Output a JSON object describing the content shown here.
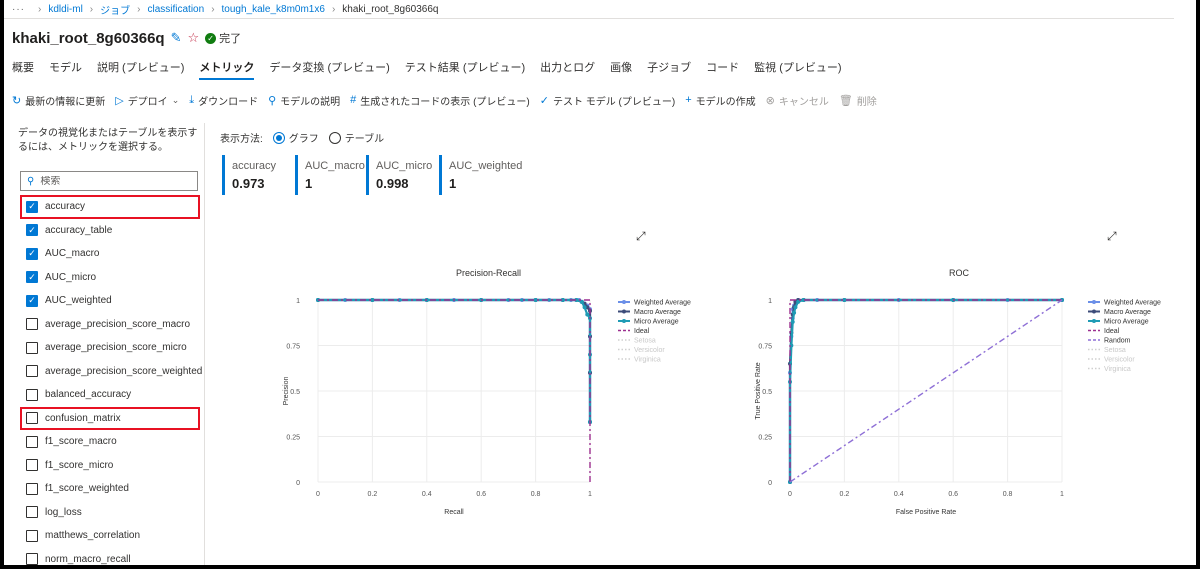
{
  "breadcrumb": {
    "dots": "···",
    "items": [
      "kdldi-ml",
      "ジョブ",
      "classification",
      "tough_kale_k8m0m1x6",
      "khaki_root_8g60366q"
    ]
  },
  "header": {
    "title": "khaki_root_8g60366q",
    "status": "完了"
  },
  "tabs": [
    "概要",
    "モデル",
    "説明 (プレビュー)",
    "メトリック",
    "データ変換 (プレビュー)",
    "テスト結果 (プレビュー)",
    "出力とログ",
    "画像",
    "子ジョブ",
    "コード",
    "監視 (プレビュー)"
  ],
  "active_tab": "メトリック",
  "toolbar": {
    "refresh": "最新の情報に更新",
    "deploy": "デプロイ",
    "download": "ダウンロード",
    "explain": "モデルの説明",
    "code": "生成されたコードの表示 (プレビュー)",
    "test": "テスト モデル (プレビュー)",
    "create": "モデルの作成",
    "cancel": "キャンセル",
    "delete": "削除"
  },
  "left_panel": {
    "instructions": "データの視覚化またはテーブルを表示するには、メトリックを選択する。",
    "search_placeholder": "検索",
    "metrics": [
      {
        "label": "accuracy",
        "checked": true,
        "highlighted": true
      },
      {
        "label": "accuracy_table",
        "checked": true,
        "highlighted": false
      },
      {
        "label": "AUC_macro",
        "checked": true,
        "highlighted": false
      },
      {
        "label": "AUC_micro",
        "checked": true,
        "highlighted": false
      },
      {
        "label": "AUC_weighted",
        "checked": true,
        "highlighted": false
      },
      {
        "label": "average_precision_score_macro",
        "checked": false,
        "highlighted": false
      },
      {
        "label": "average_precision_score_micro",
        "checked": false,
        "highlighted": false
      },
      {
        "label": "average_precision_score_weighted",
        "checked": false,
        "highlighted": false
      },
      {
        "label": "balanced_accuracy",
        "checked": false,
        "highlighted": false
      },
      {
        "label": "confusion_matrix",
        "checked": false,
        "highlighted": true
      },
      {
        "label": "f1_score_macro",
        "checked": false,
        "highlighted": false
      },
      {
        "label": "f1_score_micro",
        "checked": false,
        "highlighted": false
      },
      {
        "label": "f1_score_weighted",
        "checked": false,
        "highlighted": false
      },
      {
        "label": "log_loss",
        "checked": false,
        "highlighted": false
      },
      {
        "label": "matthews_correlation",
        "checked": false,
        "highlighted": false
      },
      {
        "label": "norm_macro_recall",
        "checked": false,
        "highlighted": false
      }
    ]
  },
  "view": {
    "label": "表示方法:",
    "graph": "グラフ",
    "table": "テーブル",
    "selected": "graph"
  },
  "cards": [
    {
      "name": "accuracy",
      "value": "0.973"
    },
    {
      "name": "AUC_macro",
      "value": "1"
    },
    {
      "name": "AUC_micro",
      "value": "0.998"
    },
    {
      "name": "AUC_weighted",
      "value": "1"
    }
  ],
  "colors": {
    "accent": "#0078d4",
    "weighted": "#6b8fe8",
    "macro": "#3d4c7a",
    "micro": "#1f9bb5",
    "ideal": "#9c2f8f",
    "random": "#8e6fd6",
    "hidden": "#cfcfcf",
    "highlight": "#e81123"
  },
  "chart_data": [
    {
      "type": "line",
      "title": "Precision-Recall",
      "xlabel": "Recall",
      "ylabel": "Precision",
      "xlim": [
        0,
        1
      ],
      "ylim": [
        0,
        1
      ],
      "xticks": [
        "0",
        "0.2",
        "0.4",
        "0.6",
        "0.8",
        "1"
      ],
      "yticks": [
        "0",
        "0.25",
        "0.5",
        "0.75",
        "1"
      ],
      "grid": true,
      "legend_position": "right",
      "series": [
        {
          "name": "Weighted Average",
          "style": "line-marker",
          "color_key": "weighted",
          "x": [
            0,
            0.1,
            0.2,
            0.3,
            0.4,
            0.5,
            0.6,
            0.7,
            0.75,
            0.8,
            0.85,
            0.9,
            0.93,
            0.96,
            0.97,
            0.98,
            0.99,
            1.0,
            1.0,
            1.0,
            1.0
          ],
          "y": [
            1,
            1,
            1,
            1,
            1,
            1,
            1,
            1,
            1,
            1,
            1,
            1,
            1,
            1,
            0.99,
            0.98,
            0.97,
            0.95,
            0.8,
            0.6,
            0.33
          ]
        },
        {
          "name": "Macro Average",
          "style": "line-marker",
          "color_key": "macro",
          "x": [
            0,
            0.2,
            0.4,
            0.6,
            0.8,
            0.9,
            0.95,
            0.97,
            0.98,
            0.99,
            1.0,
            1.0,
            1.0,
            1.0
          ],
          "y": [
            1,
            1,
            1,
            1,
            1,
            1,
            1,
            0.99,
            0.98,
            0.96,
            0.94,
            0.8,
            0.6,
            0.33
          ]
        },
        {
          "name": "Micro Average",
          "style": "line-marker",
          "color_key": "micro",
          "x": [
            0,
            0.2,
            0.4,
            0.6,
            0.8,
            0.9,
            0.95,
            0.97,
            0.98,
            0.99,
            1.0,
            1.0,
            1.0
          ],
          "y": [
            1,
            1,
            1,
            1,
            1,
            1,
            1,
            0.99,
            0.96,
            0.92,
            0.9,
            0.7,
            0.33
          ]
        },
        {
          "name": "Ideal",
          "style": "dash",
          "color_key": "ideal",
          "x": [
            0,
            1,
            1
          ],
          "y": [
            1,
            1,
            0
          ]
        },
        {
          "name": "Setosa",
          "style": "hidden",
          "color_key": "hidden",
          "x": [],
          "y": []
        },
        {
          "name": "Versicolor",
          "style": "hidden",
          "color_key": "hidden",
          "x": [],
          "y": []
        },
        {
          "name": "Virginica",
          "style": "hidden",
          "color_key": "hidden",
          "x": [],
          "y": []
        }
      ]
    },
    {
      "type": "line",
      "title": "ROC",
      "xlabel": "False Positive Rate",
      "ylabel": "True Positive Rate",
      "xlim": [
        0,
        1
      ],
      "ylim": [
        0,
        1
      ],
      "xticks": [
        "0",
        "0.2",
        "0.4",
        "0.6",
        "0.8",
        "1"
      ],
      "yticks": [
        "0",
        "0.25",
        "0.5",
        "0.75",
        "1"
      ],
      "grid": true,
      "legend_position": "right",
      "series": [
        {
          "name": "Weighted Average",
          "style": "line-marker",
          "color_key": "weighted",
          "x": [
            0,
            0,
            0.005,
            0.01,
            0.01,
            0.015,
            0.02,
            0.03,
            0.05,
            0.1,
            0.2,
            0.4,
            0.6,
            0.8,
            1.0
          ],
          "y": [
            0,
            0.6,
            0.8,
            0.9,
            0.95,
            0.97,
            0.99,
            1,
            1,
            1,
            1,
            1,
            1,
            1,
            1
          ]
        },
        {
          "name": "Macro Average",
          "style": "line-marker",
          "color_key": "macro",
          "x": [
            0,
            0,
            0.005,
            0.01,
            0.015,
            0.02,
            0.03,
            0.05,
            0.2,
            0.6,
            1.0
          ],
          "y": [
            0,
            0.65,
            0.82,
            0.92,
            0.96,
            0.99,
            1,
            1,
            1,
            1,
            1
          ]
        },
        {
          "name": "Micro Average",
          "style": "line-marker",
          "color_key": "micro",
          "x": [
            0,
            0,
            0.005,
            0.01,
            0.015,
            0.02,
            0.03,
            0.05,
            0.2,
            0.6,
            1.0
          ],
          "y": [
            0,
            0.55,
            0.75,
            0.88,
            0.93,
            0.96,
            0.99,
            1,
            1,
            1,
            1
          ]
        },
        {
          "name": "Ideal",
          "style": "dash",
          "color_key": "ideal",
          "x": [
            0,
            0,
            1
          ],
          "y": [
            0,
            1,
            1
          ]
        },
        {
          "name": "Random",
          "style": "dash",
          "color_key": "random",
          "x": [
            0,
            1
          ],
          "y": [
            0,
            1
          ]
        },
        {
          "name": "Setosa",
          "style": "hidden",
          "color_key": "hidden",
          "x": [],
          "y": []
        },
        {
          "name": "Versicolor",
          "style": "hidden",
          "color_key": "hidden",
          "x": [],
          "y": []
        },
        {
          "name": "Virginica",
          "style": "hidden",
          "color_key": "hidden",
          "x": [],
          "y": []
        }
      ]
    }
  ]
}
